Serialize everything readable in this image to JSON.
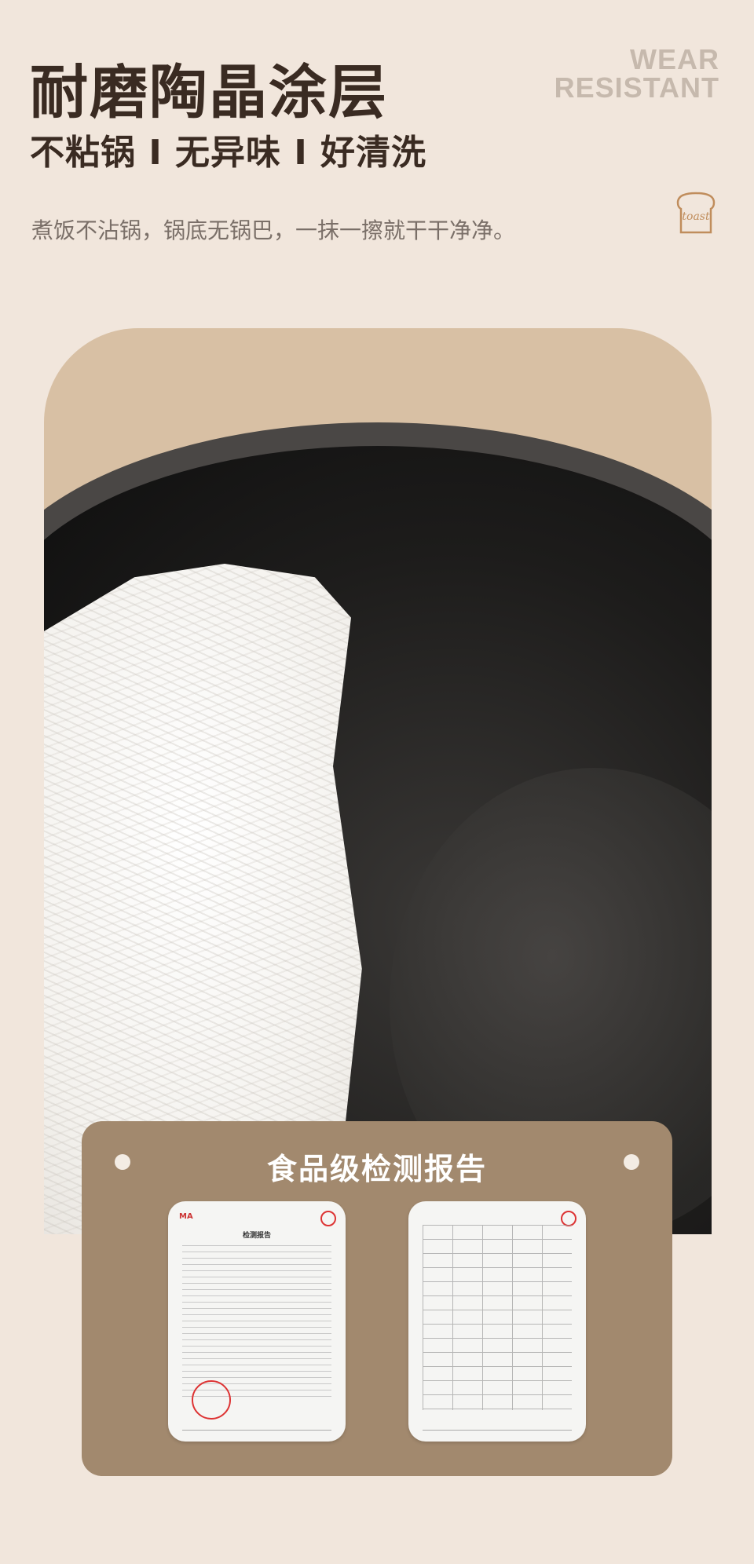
{
  "header": {
    "title": "耐磨陶晶涂层",
    "subtitle": "不粘锅 I 无异味 I 好清洗",
    "description": "煮饭不沾锅，锅底无锅巴，一抹一擦就干干净净。",
    "en_line1": "WEAR",
    "en_line2": "RESISTANT",
    "logo_text": "toast"
  },
  "report": {
    "title": "食品级检测报告",
    "doc1_title": "检测报告",
    "doc1_brand": "MA"
  },
  "colors": {
    "background": "#f1e6dc",
    "title": "#3a2b22",
    "card": "#a2896e",
    "accent": "#d8c0a4"
  }
}
